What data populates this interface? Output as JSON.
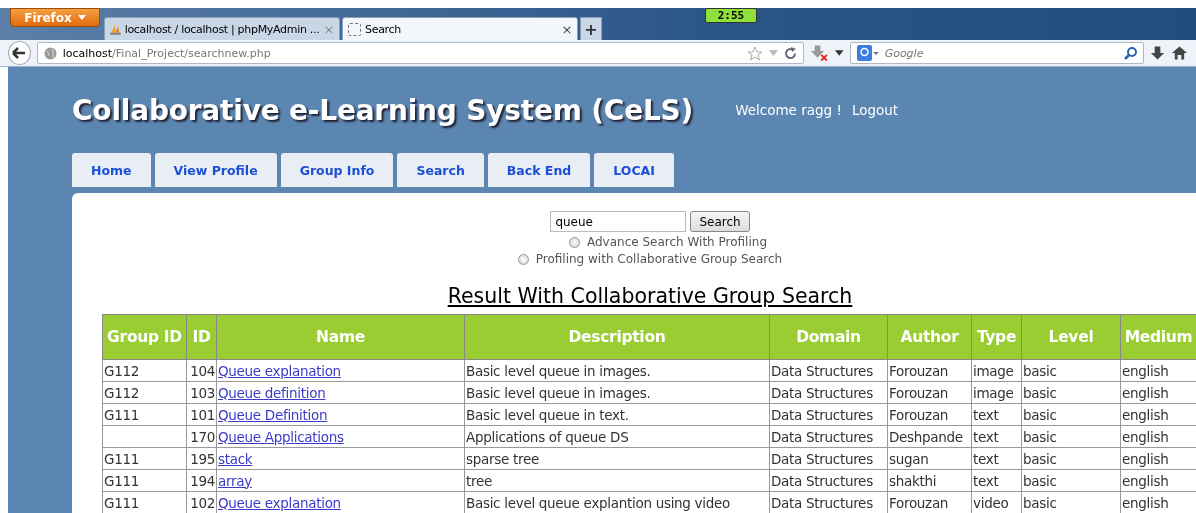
{
  "browser": {
    "menu_button": "Firefox",
    "tabs": [
      {
        "title": "localhost / localhost | phpMyAdmin ...",
        "close": "×",
        "selected": false
      },
      {
        "title": "Search",
        "close": "×",
        "selected": true
      }
    ],
    "new_tab": "+",
    "clock": "2:55",
    "address": {
      "host": "localhost",
      "path": "/Final_Project/searchnew.php"
    },
    "search": {
      "placeholder": "Google"
    }
  },
  "header": {
    "title": "Collaborative e-Learning System (CeLS)",
    "welcome": "Welcome ragg !",
    "logout": "Logout"
  },
  "nav": [
    {
      "label": "Home"
    },
    {
      "label": "View Profile"
    },
    {
      "label": "Group Info"
    },
    {
      "label": "Search"
    },
    {
      "label": "Back End"
    },
    {
      "label": "LOCAI"
    }
  ],
  "search_form": {
    "query": "queue",
    "button": "Search",
    "options": [
      {
        "label": "Advance Search With Profiling",
        "selected": false
      },
      {
        "label": "Profiling with Collaborative Group Search",
        "selected": false
      }
    ]
  },
  "results": {
    "heading": "Result With Collaborative Group Search",
    "columns": [
      "Group ID",
      "ID",
      "Name",
      "Description",
      "Domain",
      "Author",
      "Type",
      "Level",
      "Medium"
    ],
    "rows": [
      [
        "G112",
        "104",
        "Queue explanation",
        "Basic level queue in images.",
        "Data Structures",
        "Forouzan",
        "image",
        "basic",
        "english"
      ],
      [
        "G112",
        "103",
        "Queue definition",
        "Basic level queue in images.",
        "Data Structures",
        "Forouzan",
        "image",
        "basic",
        "english"
      ],
      [
        "G111",
        "101",
        "Queue Definition",
        "Basic level queue in text.",
        "Data Structures",
        "Forouzan",
        "text",
        "basic",
        "english"
      ],
      [
        "",
        "170",
        "Queue Applications",
        "Applications of queue DS",
        "Data Structures",
        "Deshpande",
        "text",
        "basic",
        "english"
      ],
      [
        "G111",
        "195",
        "stack",
        "sparse tree",
        "Data Structures",
        "sugan",
        "text",
        "basic",
        "english"
      ],
      [
        "G111",
        "194",
        "array",
        "tree",
        "Data Structures",
        "shakthi",
        "text",
        "basic",
        "english"
      ],
      [
        "G111",
        "102",
        "Queue explanation",
        "Basic level queue explantion using video",
        "Data Structures",
        "Forouzan",
        "video",
        "basic",
        "english"
      ]
    ]
  }
}
